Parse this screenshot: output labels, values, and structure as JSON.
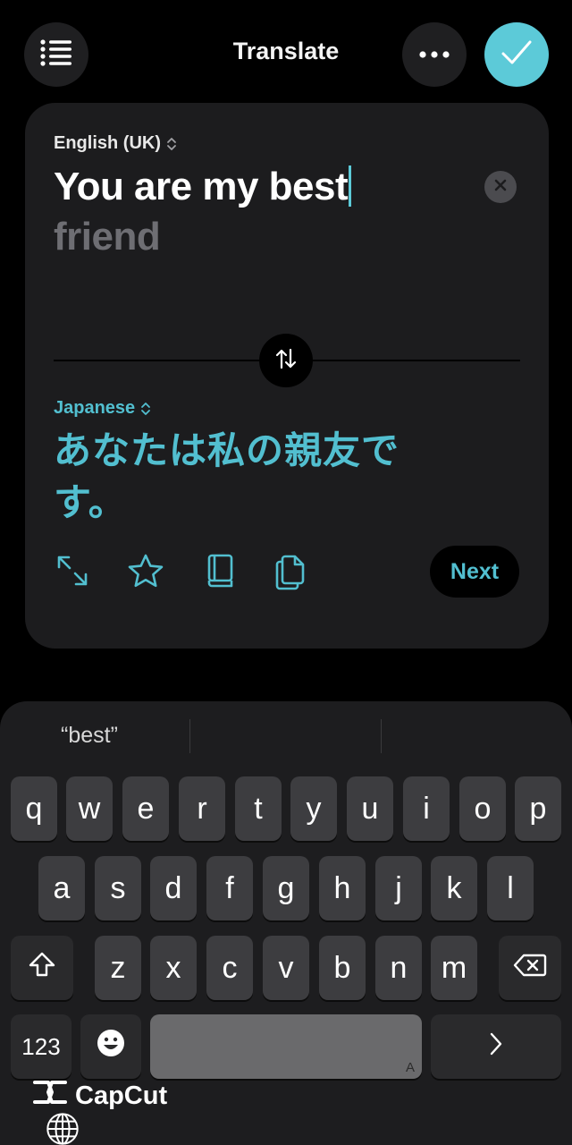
{
  "header": {
    "title": "Translate"
  },
  "source": {
    "language": "English (UK)",
    "typed": "You are my best",
    "suggestion": "friend"
  },
  "target": {
    "language": "Japanese",
    "text": "あなたは私の親友です。"
  },
  "actions": {
    "next_label": "Next"
  },
  "keyboard": {
    "suggestion": "“best”",
    "row1": [
      "q",
      "w",
      "e",
      "r",
      "t",
      "y",
      "u",
      "i",
      "o",
      "p"
    ],
    "row2": [
      "a",
      "s",
      "d",
      "f",
      "g",
      "h",
      "j",
      "k",
      "l"
    ],
    "row3": [
      "z",
      "x",
      "c",
      "v",
      "b",
      "n",
      "m"
    ],
    "numbers_label": "123",
    "space_mark": "A"
  },
  "watermark": {
    "text": "CapCut"
  },
  "colors": {
    "accent": "#5ccad8",
    "target_text": "#52bfd0",
    "card_bg": "#1c1c1e"
  },
  "icons": [
    "list-icon",
    "more-icon",
    "checkmark-icon",
    "updown-icon",
    "clear-icon",
    "swap-icon",
    "expand-icon",
    "star-icon",
    "book-icon",
    "copy-icon",
    "shift-icon",
    "delete-icon",
    "emoji-icon",
    "chevron-right-icon",
    "globe-icon",
    "capcut-logo-icon"
  ]
}
